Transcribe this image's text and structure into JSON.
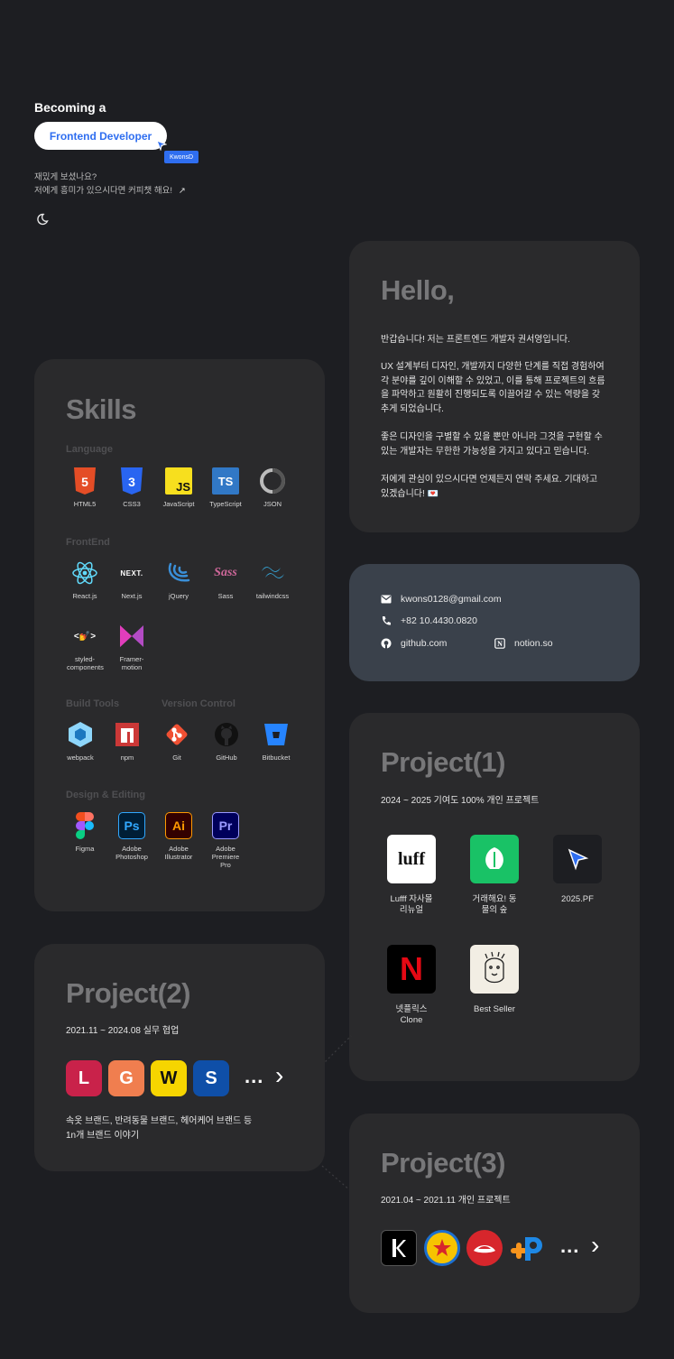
{
  "header": {
    "kicker": "Becoming a",
    "role_pill": "Frontend Developer",
    "tag": "KwonsD",
    "lines": [
      "재밌게 보셨나요?",
      "저에게 흥미가 있으시다면 커피챗 해요!"
    ],
    "coffee_arrow": "↗"
  },
  "hello": {
    "title": "Hello,",
    "paragraphs": [
      "반갑습니다! 저는 프론트엔드 개발자 권서영입니다.",
      "UX 설계부터 디자인, 개발까지 다양한 단계를 직접 경험하여 각 분야를 깊이 이해할 수 있었고, 이를 통해 프로젝트의 흐름을 파악하고 원활히 진행되도록 이끌어갈 수 있는 역량을 갖추게 되었습니다.",
      "좋은 디자인을 구별할 수 있을 뿐만 아니라 그것을 구현할 수 있는 개발자는 무한한 가능성을 가지고 있다고 믿습니다.",
      "저에게 관심이 있으시다면 언제든지 연락 주세요. 기대하고 있겠습니다! 💌"
    ]
  },
  "contact": {
    "email": "kwons0128@gmail.com",
    "phone": "+82 10.4430.0820",
    "github": "github.com",
    "notion": "notion.so"
  },
  "skills": {
    "title": "Skills",
    "categories": [
      "Language",
      "FrontEnd",
      "Build Tools",
      "Version Control",
      "Design & Editing"
    ],
    "language": [
      "HTML5",
      "CSS3",
      "JavaScript",
      "TypeScript",
      "JSON"
    ],
    "frontend": [
      "React.js",
      "Next.js",
      "jQuery",
      "Sass",
      "tailwindcss",
      "styled-components",
      "Framer-motion"
    ],
    "build": [
      "webpack",
      "npm"
    ],
    "version": [
      "Git",
      "GitHub",
      "Bitbucket"
    ],
    "design": [
      "Figma",
      "Adobe Photoshop",
      "Adobe Illustrator",
      "Adobe Premiere Pro"
    ],
    "icon_text": {
      "js": "JS",
      "ts": "TS",
      "next": "NEXT.",
      "sass": "Sass",
      "styled": "<💅>",
      "ps": "Ps",
      "ai": "Ai",
      "pr": "Pr"
    }
  },
  "project1": {
    "title": "Project(1)",
    "sub": "2024 ~ 2025 기여도 100% 개인 프로젝트",
    "apps": [
      "Lufff 자사몰 리뉴얼",
      "거래해요! 동물의 숲",
      "2025.PF",
      "넷플릭스 Clone",
      "Best Seller"
    ],
    "luff_logo": "luff",
    "netflix_logo": "N"
  },
  "project2": {
    "title": "Project(2)",
    "sub": "2021.11 ~ 2024.08 실무 협업",
    "letters": [
      "L",
      "G",
      "W",
      "S"
    ],
    "more": "...",
    "chevron": "›",
    "desc": [
      "속옷 브랜드, 반려동물 브랜드, 헤어케어 브랜드 등",
      "1n개 브랜드 이야기"
    ]
  },
  "project3": {
    "title": "Project(3)",
    "sub": "2021.04 ~ 2021.11 개인 프로젝트",
    "more": "...",
    "chevron": "›"
  },
  "colors": {
    "bg": "#1d1e22",
    "card": "#2a2a2c",
    "contact_card": "#3a414b",
    "accent_blue": "#2f6ef0"
  }
}
